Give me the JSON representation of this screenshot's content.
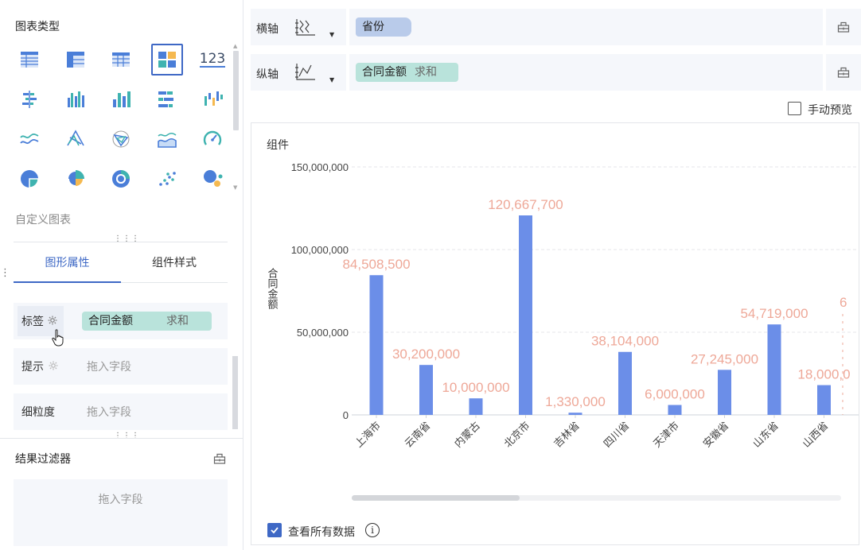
{
  "left": {
    "chart_type_title": "图表类型",
    "chart_icons": [
      "table-icon",
      "cross-table-icon",
      "detail-table-icon",
      "kpi-card-icon",
      "number-icon",
      "grouped-bar-icon",
      "column-chart-icon",
      "column-chart-alt-icon",
      "stacked-bar-icon",
      "waterfall-icon",
      "line-chart-icon",
      "radar-icon",
      "polar-icon",
      "area-chart-icon",
      "gauge-icon",
      "pie-chart-icon",
      "rose-chart-icon",
      "ring-chart-icon",
      "scatter-icon",
      "bubble-icon"
    ],
    "number_icon_text": "123",
    "custom_chart_label": "自定义图表",
    "tabs": {
      "graph_props": "图形属性",
      "component_style": "组件样式"
    },
    "props": {
      "label": {
        "label": "标签",
        "field": "合同金额",
        "agg": "求和"
      },
      "tooltip": {
        "label": "提示",
        "placeholder": "拖入字段"
      },
      "granularity": {
        "label": "细粒度",
        "placeholder": "拖入字段"
      }
    },
    "filter": {
      "title": "结果过滤器",
      "placeholder": "拖入字段"
    }
  },
  "right": {
    "x_axis": {
      "label": "横轴",
      "field": "省份"
    },
    "y_axis": {
      "label": "纵轴",
      "field": "合同金额",
      "agg": "求和"
    },
    "manual_preview": "手动预览",
    "chart_title": "组件",
    "view_all_label": "查看所有数据",
    "view_all_checked": true,
    "info_icon": "i"
  },
  "colors": {
    "accent": "#3e68c5",
    "bar": "#6b8ee8",
    "data_label": "#eea898",
    "pill_x": "#b9cbea",
    "pill_y": "#b9e3db"
  },
  "chart_data": {
    "type": "bar",
    "title": "组件",
    "ylabel": "合同金额",
    "xlabel": "",
    "categories": [
      "上海市",
      "云南省",
      "内蒙古",
      "北京市",
      "吉林省",
      "四川省",
      "天津市",
      "安徽省",
      "山东省",
      "山西省"
    ],
    "values": [
      84508500,
      30200000,
      10000000,
      120667700,
      1330000,
      38104000,
      6000000,
      27245000,
      54719000,
      18000000
    ],
    "data_labels": [
      "84,508,500",
      "30,200,000",
      "10,000,000",
      "120,667,700",
      "1,330,000",
      "38,104,000",
      "6,000,000",
      "27,245,000",
      "54,719,000",
      "18,000,0"
    ],
    "clipped_next_label": "6",
    "yticks": [
      0,
      50000000,
      100000000,
      150000000
    ],
    "ytick_labels": [
      "0",
      "50,000,000",
      "100,000,000",
      "150,000,000"
    ],
    "ylim": [
      0,
      150000000
    ],
    "grid": true
  }
}
